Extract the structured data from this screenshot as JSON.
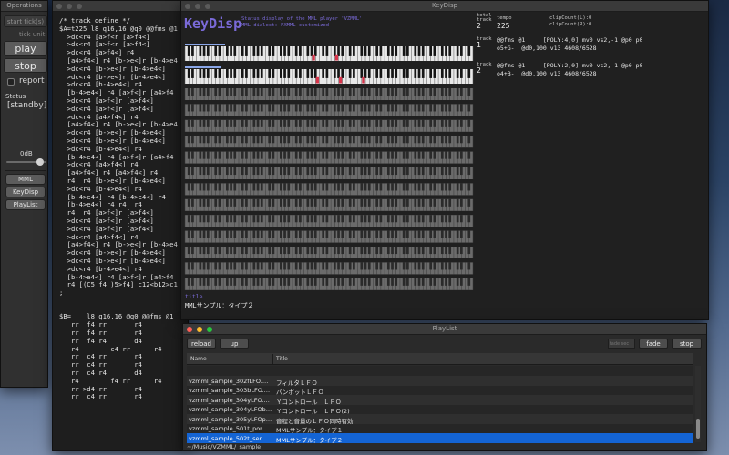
{
  "operations": {
    "window_title": "Operations",
    "start_ticks_label": "start tick(s)",
    "tick_unit_label": "tick unit",
    "play_label": "play",
    "stop_label": "stop",
    "report_label": "report",
    "status_label": "Status",
    "status_value": "[standby]",
    "volume_label": "0dB",
    "volume_level": 0.85,
    "mml_button": "MML",
    "keydisp_button": "KeyDisp",
    "playlist_button": "PlayList"
  },
  "editor": {
    "lines": [
      "/* track define */",
      "$A=t225 l8 q16,16 @q0 @@fms @1",
      "  >dc<r4 [a>f<r [a>f4<]",
      "  >dc<r4 [a>f<r [a>f4<]",
      "  >dc<r4 [a>f4<] r4",
      "  [a4>f4<] r4 [b->e<]r [b-4>e4",
      "  >dc<r4 [b->e<]r [b-4>e4<]",
      "  >dc<r4 [b->e<]r [b-4>e4<]",
      "  >dc<r4 [b-4>e4<] r4",
      "  [b-4>e4<] r4 [a>f<]r [a4>f4",
      "  >dc<r4 [a>f<]r [a>f4<]",
      "  >dc<r4 [a>f<]r [a>f4<]",
      "  >dc<r4 [a4>f4<] r4",
      "  [a4>f4<] r4 [b->e<]r [b-4>e4",
      "  >dc<r4 [b->e<]r [b-4>e4<]",
      "  >dc<r4 [b->e<]r [b-4>e4<]",
      "  >dc<r4 [b-4>e4<] r4",
      "  [b-4>e4<] r4 [a>f<]r [a4>f4",
      "  >dc<r4 [a4>f4<] r4",
      "  [a4>f4<] r4 [a4>f4<] r4",
      "  r4  r4 [b->e<]r [b-4>e4<]",
      "  >dc<r4 [b-4>e4<] r4",
      "  [b-4>e4<] r4 [b-4>e4<] r4",
      "  [b-4>e4<] r4 r4  r4",
      "  r4  r4 [a>f<]r [a>f4<]",
      "  >dc<r4 [a>f<]r [a>f4<]",
      "  >dc<r4 [a>f<]r [a>f4<]",
      "  >dc<r4 [a4>f4<] r4",
      "  [a4>f4<] r4 [b->e<]r [b-4>e4",
      "  >dc<r4 [b->e<]r [b-4>e4<]",
      "  >dc<r4 [b->e<]r [b-4>e4<]",
      "  >dc<r4 [b-4>e4<] r4",
      "  [b-4>e4<] r4 [a>f<]r [a4>f4",
      "  r4 [(C5 f4 )5>f4] c12<b12>c1",
      ";",
      "",
      "",
      "$B=    l8 q16,16 @q0 @@fms @1",
      "   rr  f4 rr       r4",
      "   rr  f4 rr       r4",
      "   rr  f4 r4       d4",
      "   r4        c4 rr      r4",
      "   rr  c4 rr       r4",
      "   rr  c4 rr       r4",
      "   rr  c4 r4       d4",
      "   r4        f4 rr      r4",
      "   rr >d4 rr       r4",
      "   rr  c4 rr       r4"
    ]
  },
  "keydisp": {
    "window_title": "KeyDisp",
    "app_name": "KeyDisp",
    "subtitle1": "Status display of the MML player 'VZMML'",
    "subtitle2": "MML dialect: FXMML customized",
    "total_track_label1": "total",
    "total_track_label2": "track",
    "total_track_value": "2",
    "tempo_label": "tempo",
    "tempo_value": "225",
    "clip_l": "clipCount(L):0",
    "clip_r": "clipCount(R):0",
    "tracks": [
      {
        "label": "track",
        "number": "1",
        "line1": "@@fms @1     [POLY:4,0] mv0 vs2,-1 @p0 p0",
        "line2": "o5+G-  @d0,100 v13 4608/6528"
      },
      {
        "label": "track",
        "number": "2",
        "line1": "@@fms @1     [POLY:2,0] mv0 vs2,-1 @p0 p0",
        "line2": "o4+B-  @d0,100 v13 4608/6528"
      }
    ],
    "title_label": "title",
    "title_value": "MMLサンプル：タイプ２",
    "colors": {
      "accent": "#7a6ad8",
      "active_key": "#d8344a",
      "highlight_bar": "#8aa6e8"
    }
  },
  "playlist": {
    "window_title": "PlayList",
    "reload_label": "reload",
    "up_label": "up",
    "fade_sec_placeholder": "fade sec",
    "fade_label": "fade",
    "stop_label": "stop",
    "col_name": "Name",
    "col_title": "Title",
    "rows": [
      {
        "name": "",
        "title": ""
      },
      {
        "name": "vzmml_sample_302fLFO.…",
        "title": "フィルタＬＦＯ"
      },
      {
        "name": "vzmml_sample_303bLFO.…",
        "title": "バンポットＬＦＯ"
      },
      {
        "name": "vzmml_sample_304yLFO.…",
        "title": "Ｙコントロール　ＬＦＯ"
      },
      {
        "name": "vzmml_sample_304yLFOb…",
        "title": "Ｙコントロール　ＬＦＯ(2)"
      },
      {
        "name": "vzmml_sample_305yLFOp…",
        "title": "音程と音量のＬＦＯ同時有効"
      },
      {
        "name": "vzmml_sample_501t_por…",
        "title": "MMLサンプル：タイプ１"
      },
      {
        "name": "vzmml_sample_502t_ser…",
        "title": "MMLサンプル：タイプ２"
      }
    ],
    "selected_index": 7,
    "status_path": "~/Music/VZMML/_sample",
    "colors": {
      "selection": "#1464d4"
    }
  }
}
